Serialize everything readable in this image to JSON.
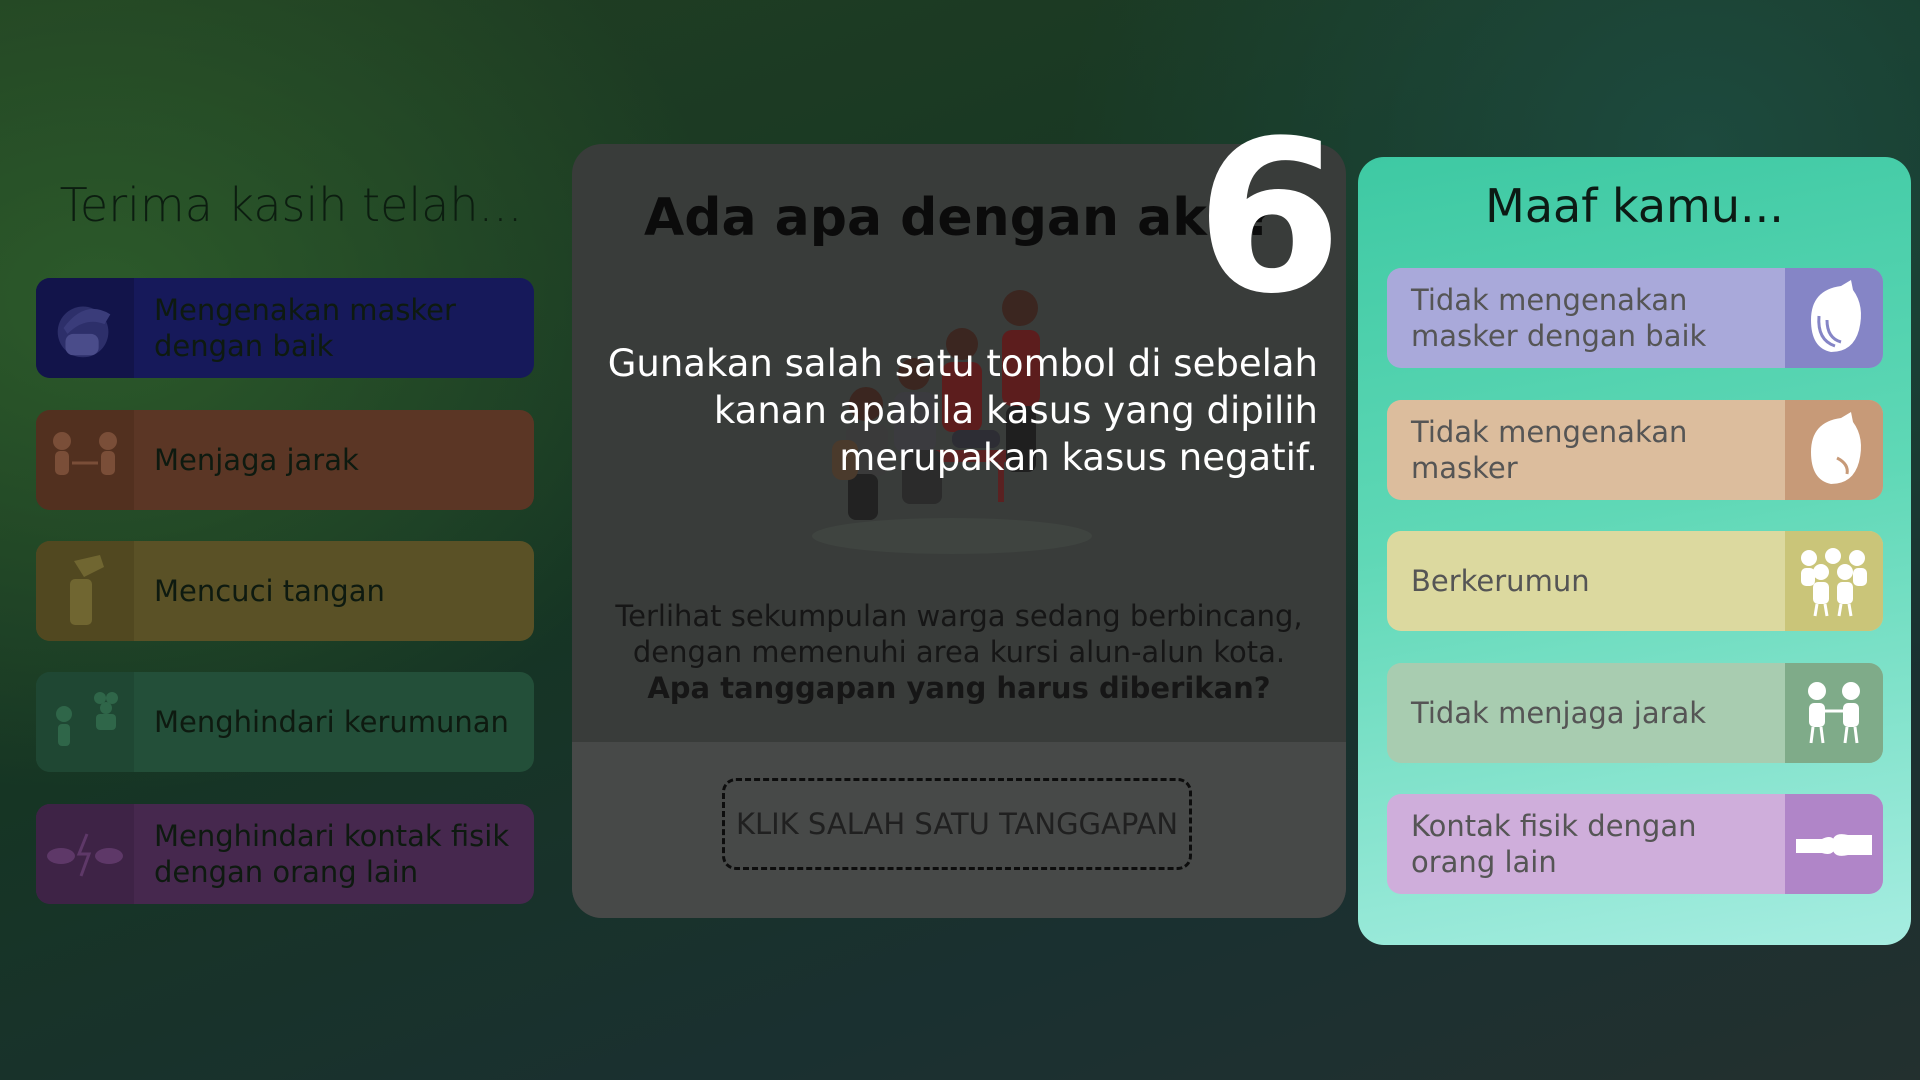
{
  "left_panel": {
    "title": "Terima kasih telah...",
    "items": [
      {
        "label": "Mengenakan masker dengan baik",
        "icon": "helmet-mask-icon",
        "color": "#16195a",
        "icon_bg": "#12144a"
      },
      {
        "label": "Menjaga jarak",
        "icon": "distance-people-icon",
        "color": "#5b3625",
        "icon_bg": "#52301f"
      },
      {
        "label": "Mencuci tangan",
        "icon": "spray-bottle-icon",
        "color": "#5a5126",
        "icon_bg": "#514820"
      },
      {
        "label": "Menghindari kerumunan",
        "icon": "crowd-avoid-icon",
        "color": "#234f39",
        "icon_bg": "#1f4733"
      },
      {
        "label": "Menghindari kontak fisik dengan orang lain",
        "icon": "no-contact-icon",
        "color": "#46284e",
        "icon_bg": "#3e2346"
      }
    ]
  },
  "center_panel": {
    "title": "Ada apa dengan aku?",
    "description": "Terlihat sekumpulan warga sedang berbincang, dengan memenuhi area kursi alun-alun kota.",
    "question": "Apa tanggapan yang harus diberikan?",
    "cta_label": "KLIK SALAH SATU TANGGAPAN",
    "scene_icon": "people-gathering-illustration"
  },
  "tutorial": {
    "step": "6",
    "hint": "Gunakan salah satu tombol di sebelah kanan apabila kasus yang dipilih merupakan kasus negatif."
  },
  "right_panel": {
    "title": "Maaf kamu...",
    "items": [
      {
        "label": "Tidak mengenakan masker dengan baik",
        "icon": "helmet-loose-mask-icon",
        "color": "#a9a9da",
        "icon_bg": "#8585c6"
      },
      {
        "label": "Tidak mengenakan masker",
        "icon": "helmet-no-mask-icon",
        "color": "#dcbd9d",
        "icon_bg": "#c79a78"
      },
      {
        "label": "Berkerumun",
        "icon": "crowd-icon",
        "color": "#dcd99f",
        "icon_bg": "#cac579"
      },
      {
        "label": "Tidak menjaga jarak",
        "icon": "close-people-icon",
        "color": "#a8ccb0",
        "icon_bg": "#7fab89"
      },
      {
        "label": "Kontak fisik dengan orang lain",
        "icon": "fist-bump-icon",
        "color": "#cfaedb",
        "icon_bg": "#b085c8"
      }
    ]
  }
}
